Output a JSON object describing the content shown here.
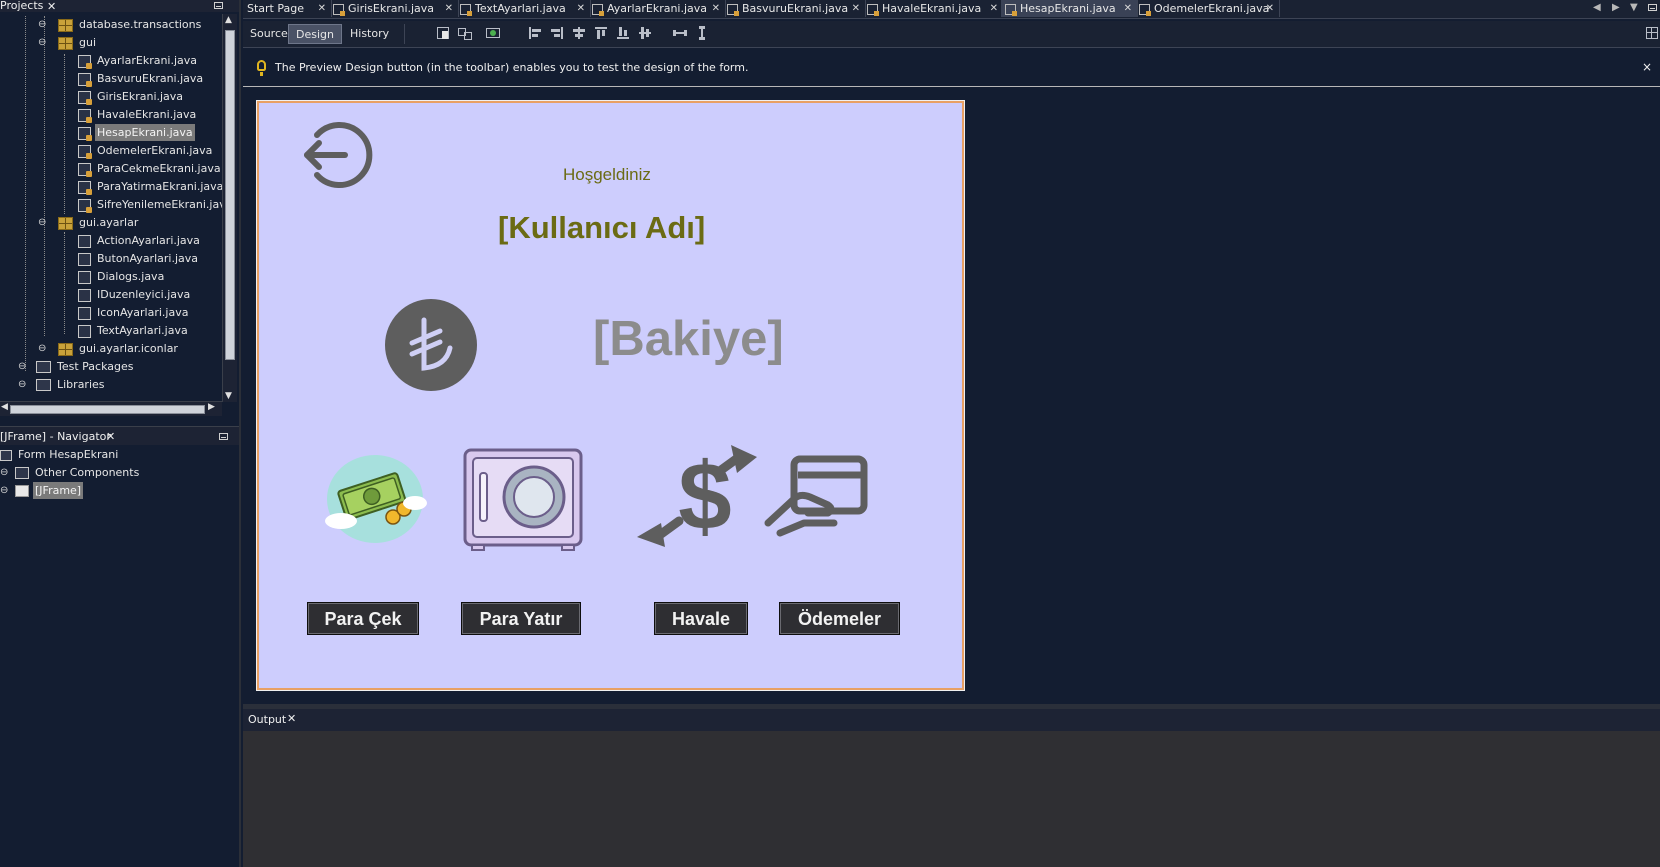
{
  "projects_panel": {
    "title": "Projects",
    "tree": [
      {
        "label": "database.transactions",
        "kind": "package"
      },
      {
        "label": "gui",
        "kind": "package"
      },
      {
        "label": "AyarlarEkrani.java",
        "kind": "form"
      },
      {
        "label": "BasvuruEkrani.java",
        "kind": "form"
      },
      {
        "label": "GirisEkrani.java",
        "kind": "form"
      },
      {
        "label": "HavaleEkrani.java",
        "kind": "form"
      },
      {
        "label": "HesapEkrani.java",
        "kind": "form",
        "selected": true
      },
      {
        "label": "OdemelerEkrani.java",
        "kind": "form"
      },
      {
        "label": "ParaCekmeEkrani.java",
        "kind": "form"
      },
      {
        "label": "ParaYatirmaEkrani.java",
        "kind": "form"
      },
      {
        "label": "SifreYenilemeEkrani.java",
        "kind": "form"
      },
      {
        "label": "gui.ayarlar",
        "kind": "package"
      },
      {
        "label": "ActionAyarlari.java",
        "kind": "java"
      },
      {
        "label": "ButonAyarlari.java",
        "kind": "java"
      },
      {
        "label": "Dialogs.java",
        "kind": "java"
      },
      {
        "label": "IDuzenleyici.java",
        "kind": "interface"
      },
      {
        "label": "IconAyarlari.java",
        "kind": "java"
      },
      {
        "label": "TextAyarlari.java",
        "kind": "java"
      },
      {
        "label": "gui.ayarlar.iconlar",
        "kind": "package"
      },
      {
        "label": "Test Packages",
        "kind": "library"
      },
      {
        "label": "Libraries",
        "kind": "library"
      }
    ]
  },
  "navigator_panel": {
    "title": "[JFrame] - Navigator",
    "tree": [
      {
        "label": "Form HesapEkrani"
      },
      {
        "label": "Other Components"
      },
      {
        "label": "[JFrame]",
        "selected": true
      }
    ]
  },
  "editor_tabs": [
    {
      "label": "Start Page",
      "active": false
    },
    {
      "label": "GirisEkrani.java",
      "active": false
    },
    {
      "label": "TextAyarlari.java",
      "active": false
    },
    {
      "label": "AyarlarEkrani.java",
      "active": false
    },
    {
      "label": "BasvuruEkrani.java",
      "active": false
    },
    {
      "label": "HavaleEkrani.java",
      "active": false
    },
    {
      "label": "HesapEkrani.java",
      "active": true
    },
    {
      "label": "OdemelerEkrani.java",
      "active": false
    }
  ],
  "toolbar": {
    "source_label": "Source",
    "design_label": "Design",
    "history_label": "History",
    "active_view": "Design"
  },
  "hint": {
    "message": "The Preview Design button (in the toolbar) enables you to test the design of the form."
  },
  "form": {
    "welcome": "Hoşgeldiniz",
    "username": "[Kullanıcı Adı]",
    "balance": "[Bakiye]",
    "buttons": {
      "withdraw": "Para Çek",
      "deposit": "Para Yatır",
      "transfer": "Havale",
      "payments": "Ödemeler"
    }
  },
  "output_panel": {
    "title": "Output"
  },
  "colors": {
    "ide_background": "#131d31",
    "form_background": "#cdcdfd",
    "form_border": "#e8a064",
    "title_text": "#6b6b14",
    "balance_text": "#8c8c8c",
    "button_background": "#2e2e32",
    "selection": "#7a7a7a",
    "output_background": "#2f2f33"
  }
}
